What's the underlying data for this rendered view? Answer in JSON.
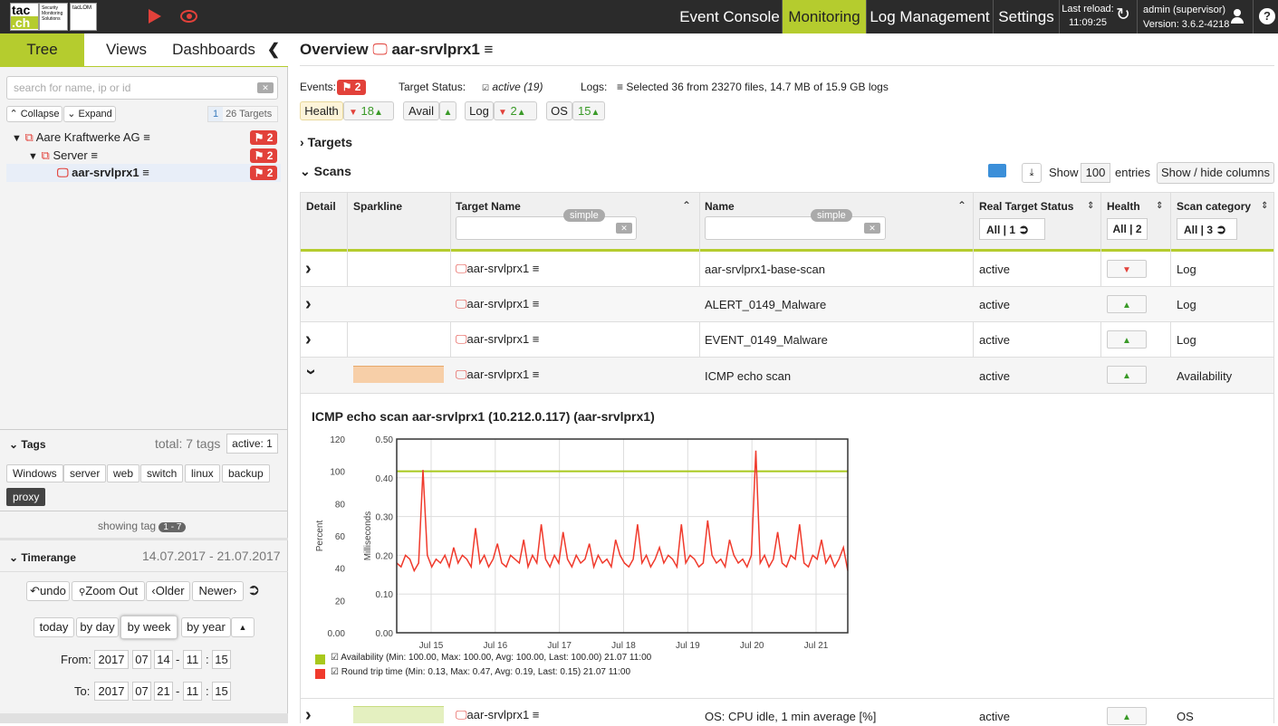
{
  "topbar": {
    "logo_main": "tac",
    "logo_sub": ".ch",
    "logo_tag": "Security Monitoring Solutions",
    "logo2": "tacLOM",
    "nav": [
      "Event Console",
      "Monitoring",
      "Log Management",
      "Settings"
    ],
    "active_nav": "Monitoring",
    "last_reload_label": "Last reload:",
    "last_reload_time": "11:09:25",
    "user": "admin (supervisor)",
    "version": "Version: 3.6.2-4218",
    "help": "?"
  },
  "left": {
    "tabs": [
      "Tree",
      "Views",
      "Dashboards"
    ],
    "search_placeholder": "search for name, ip or id",
    "collapse": "Collapse",
    "expand": "Expand",
    "count_num": "1",
    "count_label": "26 Targets",
    "tree": [
      {
        "label": "Aare Kraftwerke AG",
        "badge": "2"
      },
      {
        "label": "Server",
        "badge": "2"
      },
      {
        "label": "aar-srvlprx1",
        "badge": "2"
      }
    ],
    "tags_title": "Tags",
    "tags_total": "total: 7 tags",
    "tags_active": "active: 1",
    "tags": [
      "Windows",
      "server",
      "web",
      "switch",
      "linux",
      "backup",
      "proxy"
    ],
    "showing_tag": "showing tag",
    "showing_range": "1 - 7",
    "timerange_title": "Timerange",
    "timerange_value": "14.07.2017 - 21.07.2017",
    "buttons_row1": [
      "undo",
      "Zoom Out",
      "Older",
      "Newer"
    ],
    "buttons_row2": [
      "today",
      "by day",
      "by week",
      "by year"
    ],
    "from_label": "From:",
    "to_label": "To:",
    "from": [
      "2017",
      "07",
      "14",
      "11",
      "15"
    ],
    "to": [
      "2017",
      "07",
      "21",
      "11",
      "15"
    ]
  },
  "main": {
    "title_prefix": "Overview",
    "title_host": "aar-srvlprx1",
    "events_label": "Events:",
    "events_badge": "2",
    "target_status_label": "Target Status:",
    "target_status_value": "active (19)",
    "logs_label": "Logs:",
    "logs_value": "Selected 36 from 23270 files, 14.7 MB of 15.9 GB logs",
    "chips": [
      {
        "label": "Health",
        "down": "",
        "up": "18"
      },
      {
        "label": "Avail",
        "up": ""
      },
      {
        "label": "Log",
        "down": "",
        "up": "2"
      },
      {
        "label": "OS",
        "up": "15"
      }
    ],
    "targets_section": "Targets",
    "scans_section": "Scans",
    "show_label": "Show",
    "show_value": "100",
    "entries_label": "entries",
    "show_hide": "Show / hide columns",
    "columns": [
      "Detail",
      "Sparkline",
      "Target Name",
      "Name",
      "Real Target Status",
      "Health",
      "Scan category"
    ],
    "simple": "simple",
    "status_filter": "All | 1",
    "health_filter": "All | 2",
    "category_filter": "All | 3",
    "rows": [
      {
        "target": "aar-srvlprx1",
        "name": "aar-srvlprx1-base-scan",
        "status": "active",
        "health": "down",
        "category": "Log"
      },
      {
        "target": "aar-srvlprx1",
        "name": "ALERT_0149_Malware",
        "status": "active",
        "health": "up",
        "category": "Log"
      },
      {
        "target": "aar-srvlprx1",
        "name": "EVENT_0149_Malware",
        "status": "active",
        "health": "up",
        "category": "Log"
      },
      {
        "target": "aar-srvlprx1",
        "name": "ICMP echo scan",
        "status": "active",
        "health": "up",
        "category": "Availability"
      },
      {
        "target": "aar-srvlprx1",
        "name": "OS: CPU idle, 1 min average [%]",
        "status": "active",
        "health": "up",
        "category": "OS"
      }
    ]
  },
  "chart_data": {
    "type": "line",
    "title": "ICMP echo scan aar-srvlprx1 (10.212.0.117) (aar-srvlprx1)",
    "ylabel_left": "Percent",
    "ylabel_right": "Milliseconds",
    "ylim_percent": [
      0,
      120
    ],
    "ylim_ms": [
      0,
      0.5
    ],
    "yticks_percent": [
      "0.00",
      "20",
      "40",
      "60",
      "80",
      "100",
      "120"
    ],
    "yticks_ms": [
      "0.00",
      "0.10",
      "0.20",
      "0.30",
      "0.40",
      "0.50"
    ],
    "x_ticks": [
      "Jul 15",
      "Jul 16",
      "Jul 17",
      "Jul 18",
      "Jul 19",
      "Jul 20",
      "Jul 21"
    ],
    "grid": true,
    "series": [
      {
        "name": "Availability",
        "color": "#a8c81c",
        "values_percent": [
          100,
          100
        ],
        "legend": "Availability (Min: 100.00, Max: 100.00, Avg: 100.00, Last: 100.00) 21.07 11:00"
      },
      {
        "name": "Round trip time",
        "color": "#f03a2c",
        "legend": "Round trip time (Min: 0.13, Max: 0.47, Avg: 0.19, Last: 0.15) 21.07 11:00",
        "values_ms": [
          0.18,
          0.17,
          0.2,
          0.19,
          0.16,
          0.18,
          0.42,
          0.2,
          0.17,
          0.19,
          0.18,
          0.2,
          0.17,
          0.22,
          0.18,
          0.2,
          0.19,
          0.17,
          0.27,
          0.18,
          0.2,
          0.17,
          0.19,
          0.23,
          0.18,
          0.17,
          0.2,
          0.19,
          0.18,
          0.24,
          0.17,
          0.2,
          0.18,
          0.28,
          0.19,
          0.17,
          0.2,
          0.18,
          0.26,
          0.19,
          0.17,
          0.2,
          0.18,
          0.19,
          0.23,
          0.17,
          0.2,
          0.18,
          0.19,
          0.17,
          0.24,
          0.2,
          0.18,
          0.17,
          0.19,
          0.28,
          0.18,
          0.2,
          0.17,
          0.19,
          0.22,
          0.18,
          0.2,
          0.19,
          0.17,
          0.28,
          0.18,
          0.2,
          0.19,
          0.17,
          0.18,
          0.29,
          0.2,
          0.18,
          0.19,
          0.17,
          0.24,
          0.2,
          0.18,
          0.19,
          0.17,
          0.2,
          0.47,
          0.18,
          0.2,
          0.17,
          0.19,
          0.26,
          0.18,
          0.17,
          0.2,
          0.19,
          0.28,
          0.18,
          0.17,
          0.2,
          0.19,
          0.24,
          0.18,
          0.2,
          0.17,
          0.19,
          0.22,
          0.16
        ]
      }
    ]
  }
}
